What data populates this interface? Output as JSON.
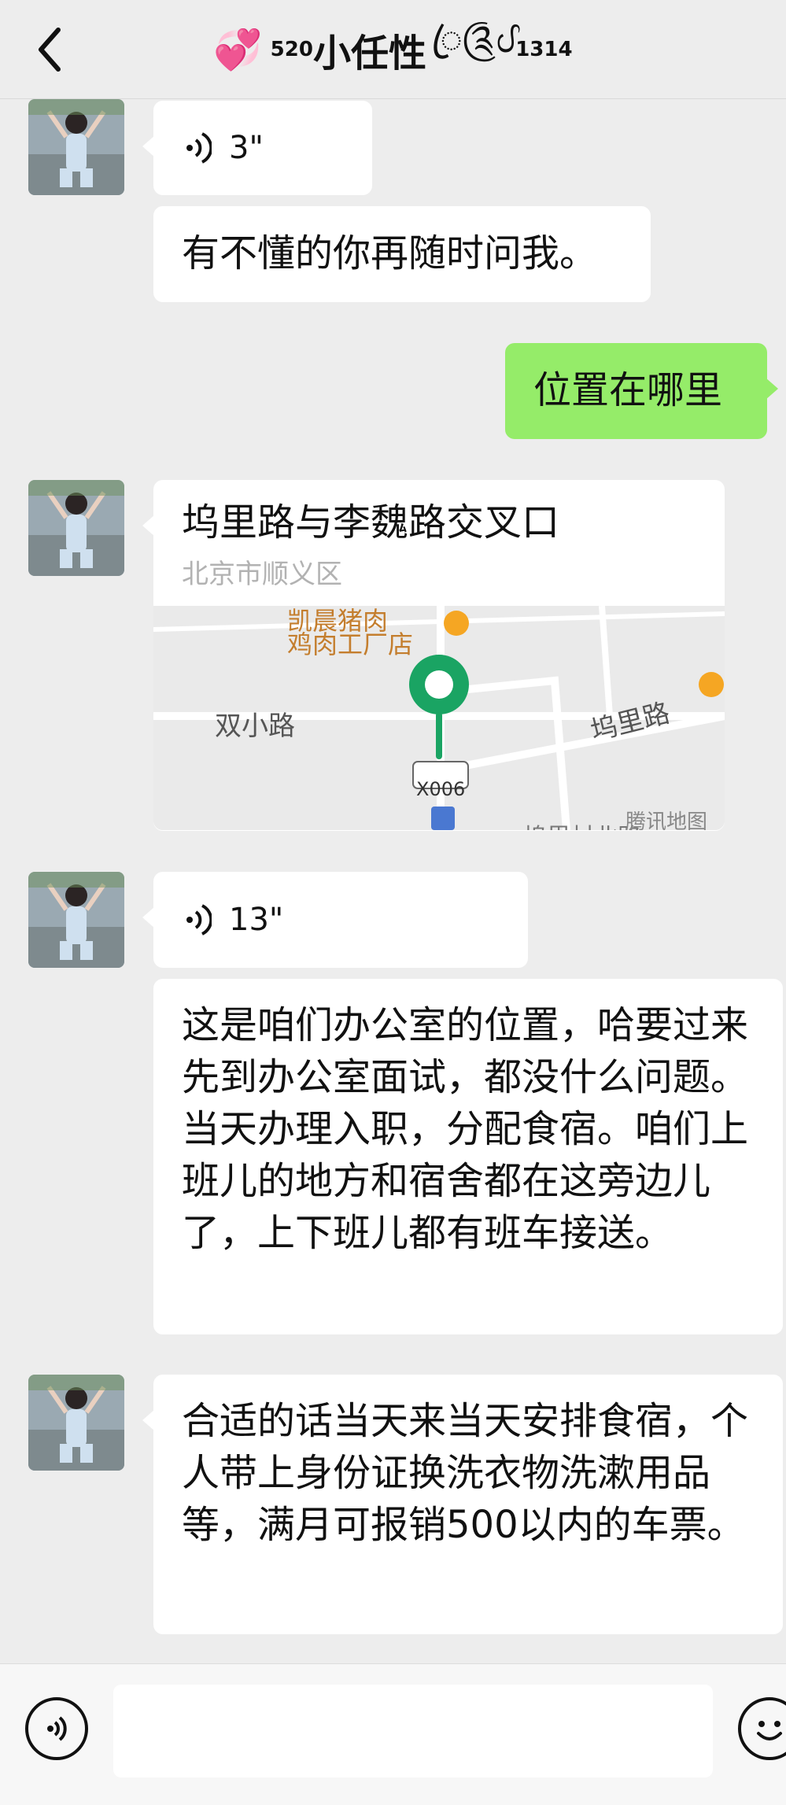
{
  "header": {
    "title_prefix_hearts": "💞",
    "title_sub5": "5",
    "title_sup20": "20",
    "title_main": "小任性",
    "title_deco": "ꦿ༊ᦔ",
    "title_sup13": "13",
    "title_sub14": "14"
  },
  "messages": [
    {
      "type": "voice",
      "duration": "3\""
    },
    {
      "type": "text",
      "text": "有不懂的你再随时问我。"
    },
    {
      "type": "text_self",
      "text": "位置在哪里"
    },
    {
      "type": "location",
      "title": "坞里路与李魏路交叉口",
      "subtitle": "北京市顺义区",
      "map_labels": {
        "poi_top": "凯晨猪肉",
        "poi_store": "鸡肉工厂店",
        "road_left": "双小路",
        "road_right": "坞里路",
        "badge": "X006",
        "bottom_road": "坞里村北路",
        "brand": "腾讯地图"
      }
    },
    {
      "type": "voice",
      "duration": "13\""
    },
    {
      "type": "text",
      "text": "这是咱们办公室的位置，哈要过来先到办公室面试，都没什么问题。当天办理入职，分配食宿。咱们上班儿的地方和宿舍都在这旁边儿了，上下班儿都有班车接送。"
    },
    {
      "type": "text",
      "text": "合适的话当天来当天安排食宿，个人带上身份证换洗衣物洗漱用品等，满月可报销500以内的车票。"
    }
  ],
  "colors": {
    "self_bubble": "#95ec69",
    "bubble": "#ffffff",
    "bg": "#ededed",
    "map_pin": "#1aa463"
  },
  "icons": {
    "back": "chevron-left-icon",
    "voice_toggle": "voice-toggle-icon",
    "emoji": "emoji-icon"
  }
}
